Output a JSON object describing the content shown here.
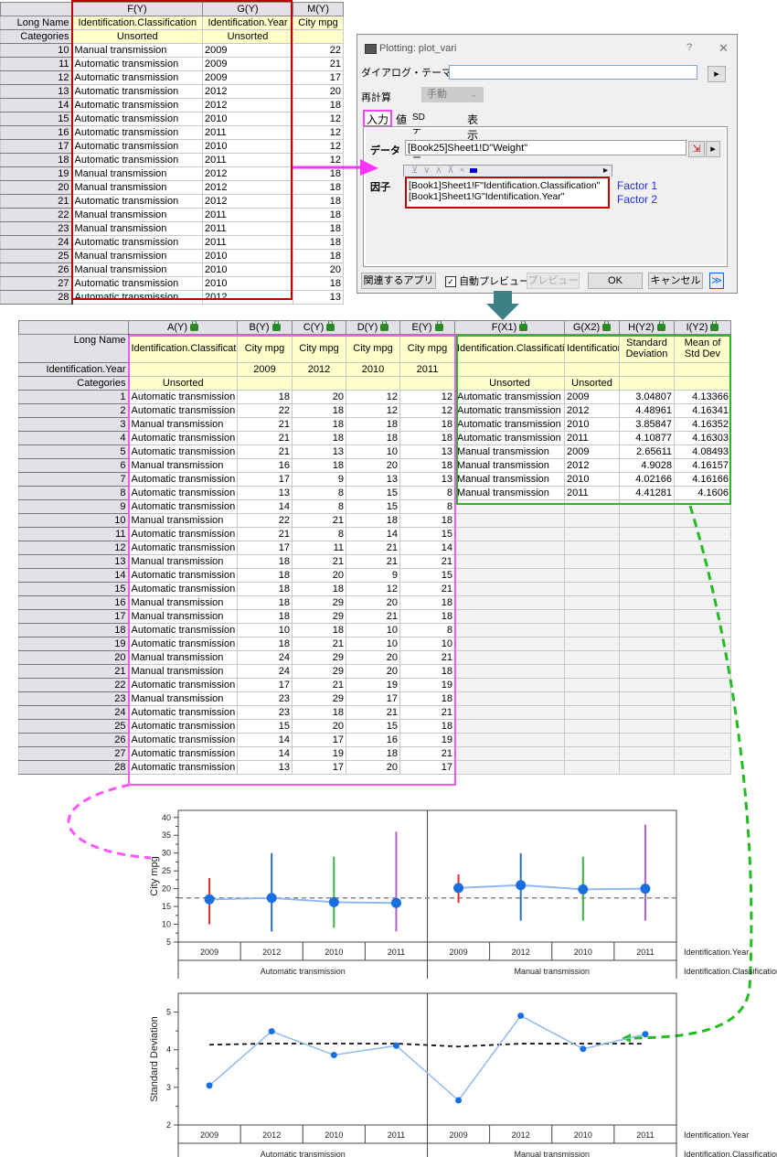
{
  "sheet1": {
    "col_headers": [
      "F(Y)",
      "G(Y)",
      "M(Y)"
    ],
    "row_labels": {
      "long_name": "Long Name",
      "categories": "Categories"
    },
    "long_names": [
      "Identification.Classification",
      "Identification.Year",
      "City mpg"
    ],
    "categories": [
      "Unsorted",
      "Unsorted",
      ""
    ],
    "rows": [
      {
        "n": "10",
        "cls": "Manual transmission",
        "year": "2009",
        "mpg": "22"
      },
      {
        "n": "11",
        "cls": "Automatic transmission",
        "year": "2009",
        "mpg": "21"
      },
      {
        "n": "12",
        "cls": "Automatic transmission",
        "year": "2009",
        "mpg": "17"
      },
      {
        "n": "13",
        "cls": "Automatic transmission",
        "year": "2012",
        "mpg": "20"
      },
      {
        "n": "14",
        "cls": "Automatic transmission",
        "year": "2012",
        "mpg": "18"
      },
      {
        "n": "15",
        "cls": "Automatic transmission",
        "year": "2010",
        "mpg": "12"
      },
      {
        "n": "16",
        "cls": "Automatic transmission",
        "year": "2011",
        "mpg": "12"
      },
      {
        "n": "17",
        "cls": "Automatic transmission",
        "year": "2010",
        "mpg": "12"
      },
      {
        "n": "18",
        "cls": "Automatic transmission",
        "year": "2011",
        "mpg": "12"
      },
      {
        "n": "19",
        "cls": "Manual transmission",
        "year": "2012",
        "mpg": "18"
      },
      {
        "n": "20",
        "cls": "Manual transmission",
        "year": "2012",
        "mpg": "18"
      },
      {
        "n": "21",
        "cls": "Automatic transmission",
        "year": "2012",
        "mpg": "18"
      },
      {
        "n": "22",
        "cls": "Manual transmission",
        "year": "2011",
        "mpg": "18"
      },
      {
        "n": "23",
        "cls": "Manual transmission",
        "year": "2011",
        "mpg": "18"
      },
      {
        "n": "24",
        "cls": "Automatic transmission",
        "year": "2011",
        "mpg": "18"
      },
      {
        "n": "25",
        "cls": "Manual transmission",
        "year": "2010",
        "mpg": "18"
      },
      {
        "n": "26",
        "cls": "Manual transmission",
        "year": "2010",
        "mpg": "20"
      },
      {
        "n": "27",
        "cls": "Automatic transmission",
        "year": "2010",
        "mpg": "18"
      },
      {
        "n": "28",
        "cls": "Automatic transmission",
        "year": "2012",
        "mpg": "13"
      }
    ]
  },
  "dialog": {
    "title": "Plotting: plot_vari",
    "help": "?",
    "close": "✕",
    "theme_label": "ダイアログ・テーマ(H)",
    "theme_value": "",
    "recalc_label": "再計算",
    "recalc_value": "手動",
    "tabs": [
      "入力",
      "値",
      "SDチャート",
      "表示"
    ],
    "data_label": "データ",
    "data_value": "[Book25]Sheet1!D\"Weight\"",
    "factor_label": "因子",
    "factors": [
      "[Book1]Sheet1!F\"Identification.Classification\"",
      "[Book1]Sheet1!G\"Identification.Year\""
    ],
    "factor_annotations": [
      "Factor 1",
      "Factor 2"
    ],
    "buttons": {
      "related_apps": "関連するアプリ",
      "auto_preview": "自動プレビュー",
      "auto_preview_checked": true,
      "preview": "プレビュー",
      "ok": "OK",
      "cancel": "キャンセル",
      "more": "≫"
    }
  },
  "sheet2": {
    "col_headers": [
      "A(Y)",
      "B(Y)",
      "C(Y)",
      "D(Y)",
      "E(Y)",
      "F(X1)",
      "G(X2)",
      "H(Y2)",
      "I(Y2)"
    ],
    "row_labels": {
      "long_name": "Long Name",
      "year": "Identification.Year",
      "categories": "Categories"
    },
    "long_names": [
      "Identification.Classification",
      "City mpg",
      "City mpg",
      "City mpg",
      "City mpg",
      "Identification.Classification",
      "Identification.Year",
      "Standard Deviation",
      "Mean of Std Dev"
    ],
    "years": [
      "",
      "2009",
      "2012",
      "2010",
      "2011",
      "",
      "",
      "",
      ""
    ],
    "categories": [
      "Unsorted",
      "",
      "",
      "",
      "",
      "Unsorted",
      "Unsorted",
      "",
      ""
    ],
    "rows": [
      [
        "1",
        "Automatic transmission",
        "18",
        "20",
        "12",
        "12",
        "Automatic transmission",
        "2009",
        "3.04807",
        "4.13366"
      ],
      [
        "2",
        "Automatic transmission",
        "22",
        "18",
        "12",
        "12",
        "Automatic transmission",
        "2012",
        "4.48961",
        "4.16341"
      ],
      [
        "3",
        "Manual transmission",
        "21",
        "18",
        "18",
        "18",
        "Automatic transmission",
        "2010",
        "3.85847",
        "4.16352"
      ],
      [
        "4",
        "Automatic transmission",
        "21",
        "18",
        "18",
        "18",
        "Automatic transmission",
        "2011",
        "4.10877",
        "4.16303"
      ],
      [
        "5",
        "Automatic transmission",
        "21",
        "13",
        "10",
        "13",
        "Manual transmission",
        "2009",
        "2.65611",
        "4.08493"
      ],
      [
        "6",
        "Manual transmission",
        "16",
        "18",
        "20",
        "18",
        "Manual transmission",
        "2012",
        "4.9028",
        "4.16157"
      ],
      [
        "7",
        "Automatic transmission",
        "17",
        "9",
        "13",
        "13",
        "Manual transmission",
        "2010",
        "4.02166",
        "4.16166"
      ],
      [
        "8",
        "Automatic transmission",
        "13",
        "8",
        "15",
        "8",
        "Manual transmission",
        "2011",
        "4.41281",
        "4.1606"
      ],
      [
        "9",
        "Automatic transmission",
        "14",
        "8",
        "15",
        "8",
        "",
        "",
        "",
        ""
      ],
      [
        "10",
        "Manual transmission",
        "22",
        "21",
        "18",
        "18",
        "",
        "",
        "",
        ""
      ],
      [
        "11",
        "Automatic transmission",
        "21",
        "8",
        "14",
        "15",
        "",
        "",
        "",
        ""
      ],
      [
        "12",
        "Automatic transmission",
        "17",
        "11",
        "21",
        "14",
        "",
        "",
        "",
        ""
      ],
      [
        "13",
        "Manual transmission",
        "18",
        "21",
        "21",
        "21",
        "",
        "",
        "",
        ""
      ],
      [
        "14",
        "Automatic transmission",
        "18",
        "20",
        "9",
        "15",
        "",
        "",
        "",
        ""
      ],
      [
        "15",
        "Automatic transmission",
        "18",
        "18",
        "12",
        "21",
        "",
        "",
        "",
        ""
      ],
      [
        "16",
        "Manual transmission",
        "18",
        "29",
        "20",
        "18",
        "",
        "",
        "",
        ""
      ],
      [
        "17",
        "Manual transmission",
        "18",
        "29",
        "21",
        "18",
        "",
        "",
        "",
        ""
      ],
      [
        "18",
        "Automatic transmission",
        "10",
        "18",
        "10",
        "8",
        "",
        "",
        "",
        ""
      ],
      [
        "19",
        "Automatic transmission",
        "18",
        "21",
        "10",
        "10",
        "",
        "",
        "",
        ""
      ],
      [
        "20",
        "Manual transmission",
        "24",
        "29",
        "20",
        "21",
        "",
        "",
        "",
        ""
      ],
      [
        "21",
        "Manual transmission",
        "24",
        "29",
        "20",
        "18",
        "",
        "",
        "",
        ""
      ],
      [
        "22",
        "Automatic transmission",
        "17",
        "21",
        "19",
        "19",
        "",
        "",
        "",
        ""
      ],
      [
        "23",
        "Manual transmission",
        "23",
        "29",
        "17",
        "18",
        "",
        "",
        "",
        ""
      ],
      [
        "24",
        "Automatic transmission",
        "23",
        "18",
        "21",
        "21",
        "",
        "",
        "",
        ""
      ],
      [
        "25",
        "Automatic transmission",
        "15",
        "20",
        "15",
        "18",
        "",
        "",
        "",
        ""
      ],
      [
        "26",
        "Automatic transmission",
        "14",
        "17",
        "16",
        "19",
        "",
        "",
        "",
        ""
      ],
      [
        "27",
        "Automatic transmission",
        "14",
        "19",
        "18",
        "21",
        "",
        "",
        "",
        ""
      ],
      [
        "28",
        "Automatic transmission",
        "13",
        "17",
        "20",
        "17",
        "",
        "",
        "",
        ""
      ]
    ]
  },
  "colors": {
    "red_box": "#c00000",
    "magenta": "#ff44ff",
    "green": "#22aa22",
    "arrow": "#3f7f86",
    "marker": "#1a6fe0",
    "line": "#8fbaf0"
  },
  "chart_data": [
    {
      "type": "scatter",
      "title": "",
      "ylabel": "City mpg",
      "ylim": [
        5,
        40
      ],
      "yticks": [
        5,
        10,
        15,
        20,
        25,
        30,
        35,
        40
      ],
      "grand_mean": 17.4,
      "x_level1_label": "Identification.Year",
      "x_level2_label": "Identification.Classification",
      "groups": [
        {
          "name": "Automatic transmission",
          "years": [
            "2009",
            "2012",
            "2010",
            "2011"
          ],
          "means": [
            17.0,
            17.4,
            16.2,
            16.0
          ],
          "mins": [
            10,
            8,
            9,
            8
          ],
          "maxs": [
            23,
            30,
            29,
            36
          ]
        },
        {
          "name": "Manual transmission",
          "years": [
            "2009",
            "2012",
            "2010",
            "2011"
          ],
          "means": [
            20.2,
            21.0,
            19.8,
            20.0
          ],
          "mins": [
            16,
            11,
            11,
            11
          ],
          "maxs": [
            24,
            30,
            29,
            38
          ]
        }
      ],
      "range_colors": [
        "#e03030",
        "#2f6fb5",
        "#3cb043",
        "#b060c8"
      ]
    },
    {
      "type": "line",
      "title": "",
      "ylabel": "Standard Deviation",
      "ylim": [
        2,
        5.5
      ],
      "yticks": [
        2,
        3,
        4,
        5
      ],
      "x_level1_label": "Identification.Year",
      "x_level2_label": "Identification.Classification",
      "groups": [
        {
          "name": "Automatic transmission",
          "years": [
            "2009",
            "2012",
            "2010",
            "2011"
          ],
          "sd": [
            3.04807,
            4.48961,
            3.85847,
            4.10877
          ],
          "mean_sd": [
            4.13366,
            4.16341,
            4.16352,
            4.16303
          ]
        },
        {
          "name": "Manual transmission",
          "years": [
            "2009",
            "2012",
            "2010",
            "2011"
          ],
          "sd": [
            2.65611,
            4.9028,
            4.02166,
            4.41281
          ],
          "mean_sd": [
            4.08493,
            4.16157,
            4.16166,
            4.1606
          ]
        }
      ]
    }
  ]
}
